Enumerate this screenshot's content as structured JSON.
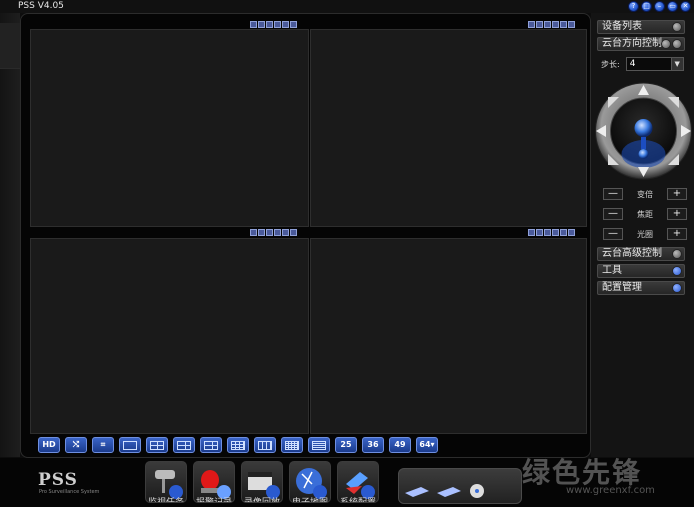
{
  "window": {
    "title": "PSS  V4.05",
    "buttons": [
      "?",
      "□",
      "–",
      "▭",
      "✕"
    ]
  },
  "video_grid": {
    "panes": 4
  },
  "layout_bar": {
    "buttons": [
      {
        "icon": "hd-icon",
        "label": "HD"
      },
      {
        "icon": "swap-icon",
        "label": "⤭"
      },
      {
        "icon": "fullscreen-icon",
        "label": "⌗"
      },
      {
        "icon": "layout-1-icon",
        "label": ""
      },
      {
        "icon": "layout-4-icon",
        "label": ""
      },
      {
        "icon": "layout-6-icon",
        "label": ""
      },
      {
        "icon": "layout-8-icon",
        "label": ""
      },
      {
        "icon": "layout-9-icon",
        "label": ""
      },
      {
        "icon": "layout-13-icon",
        "label": ""
      },
      {
        "icon": "layout-16-icon",
        "label": ""
      },
      {
        "icon": "layout-20-icon",
        "label": ""
      },
      {
        "icon": "layout-25-icon",
        "label": "25"
      },
      {
        "icon": "layout-36-icon",
        "label": "36"
      },
      {
        "icon": "layout-49-icon",
        "label": "49"
      },
      {
        "icon": "layout-64-icon",
        "label": "64▾"
      }
    ]
  },
  "sidebar": {
    "device_list": "设备列表",
    "ptz_control": "云台方向控制",
    "step_label": "步长:",
    "step_value": "4",
    "ptz_rows": [
      {
        "label": "变倍",
        "minus": "—",
        "plus": "+"
      },
      {
        "label": "焦距",
        "minus": "—",
        "plus": "+"
      },
      {
        "label": "光圈",
        "minus": "—",
        "plus": "+"
      }
    ],
    "ptz_advanced": "云台高级控制",
    "tools": "工具",
    "config": "配置管理"
  },
  "bottom": {
    "logo": "PSS",
    "logo_sub": "Pro Surveillance System",
    "tools": [
      {
        "icon": "camera-icon",
        "label": "监视任务"
      },
      {
        "icon": "alarm-icon",
        "label": "报警记录"
      },
      {
        "icon": "playback-icon",
        "label": "录像回放"
      },
      {
        "icon": "map-icon",
        "label": "电子地图"
      },
      {
        "icon": "settings-icon",
        "label": "系统配置"
      }
    ],
    "watermark": "绿色先锋",
    "watermark_url": "www.greenxf.com"
  },
  "colors": {
    "accent": "#2a5ad0",
    "background": "#0d0d0d",
    "pane": "#1a1a1a"
  }
}
